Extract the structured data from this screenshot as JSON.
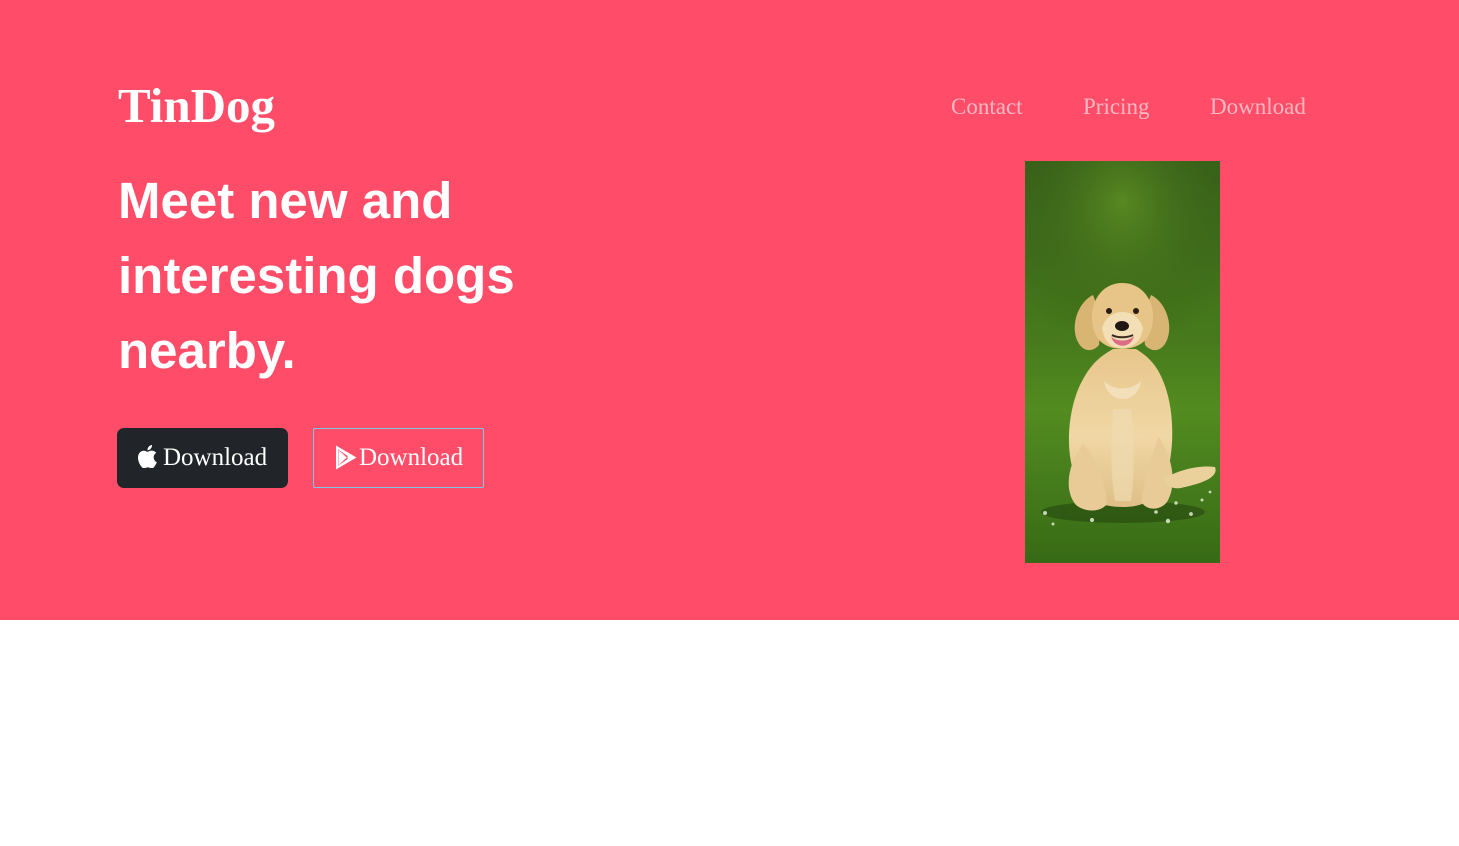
{
  "brand": {
    "name": "TinDog"
  },
  "nav": {
    "contact": "Contact",
    "pricing": "Pricing",
    "download": "Download"
  },
  "hero": {
    "headline": "Meet new and interesting dogs nearby.",
    "apple_button_label": "Download",
    "google_button_label": "Download",
    "apple_icon": "apple-icon",
    "google_icon": "google-play-icon",
    "image_subject": "golden retriever sitting on grass",
    "colors": {
      "background": "#ff4c68",
      "dark_button": "#212529",
      "outline_button_border": "#7fc6e8",
      "text": "#ffffff"
    }
  }
}
